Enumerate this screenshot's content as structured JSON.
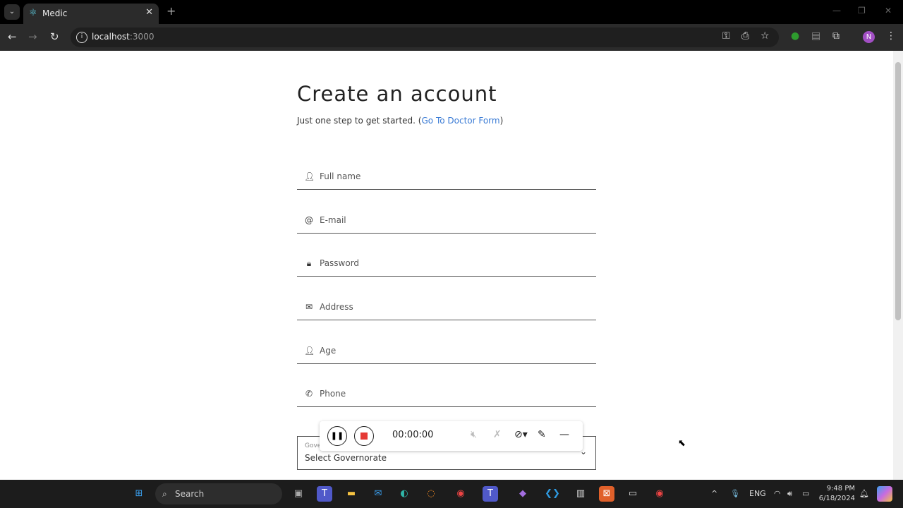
{
  "browser": {
    "tab_title": "Medic",
    "url_host": "localhost",
    "url_port": ":3000",
    "profile_initial": "N"
  },
  "page": {
    "title": "Create an account",
    "subtitle_prefix": "Just one step to get started. (",
    "doctor_link": "Go To Doctor Form",
    "subtitle_suffix": ")",
    "fields": [
      {
        "icon": "user-icon",
        "placeholder": "Full name"
      },
      {
        "icon": "at-icon",
        "placeholder": "E-mail"
      },
      {
        "icon": "lock-icon",
        "placeholder": "Password"
      },
      {
        "icon": "mail-icon",
        "placeholder": "Address"
      },
      {
        "icon": "user-icon",
        "placeholder": "Age"
      },
      {
        "icon": "phone-icon",
        "placeholder": "Phone"
      }
    ],
    "governorate": {
      "label": "Governorate",
      "value": "Select Governorate"
    }
  },
  "recorder": {
    "timer": "00:00:00"
  },
  "taskbar": {
    "search": "Search",
    "language": "ENG",
    "time": "9:48 PM",
    "date": "6/18/2024"
  }
}
